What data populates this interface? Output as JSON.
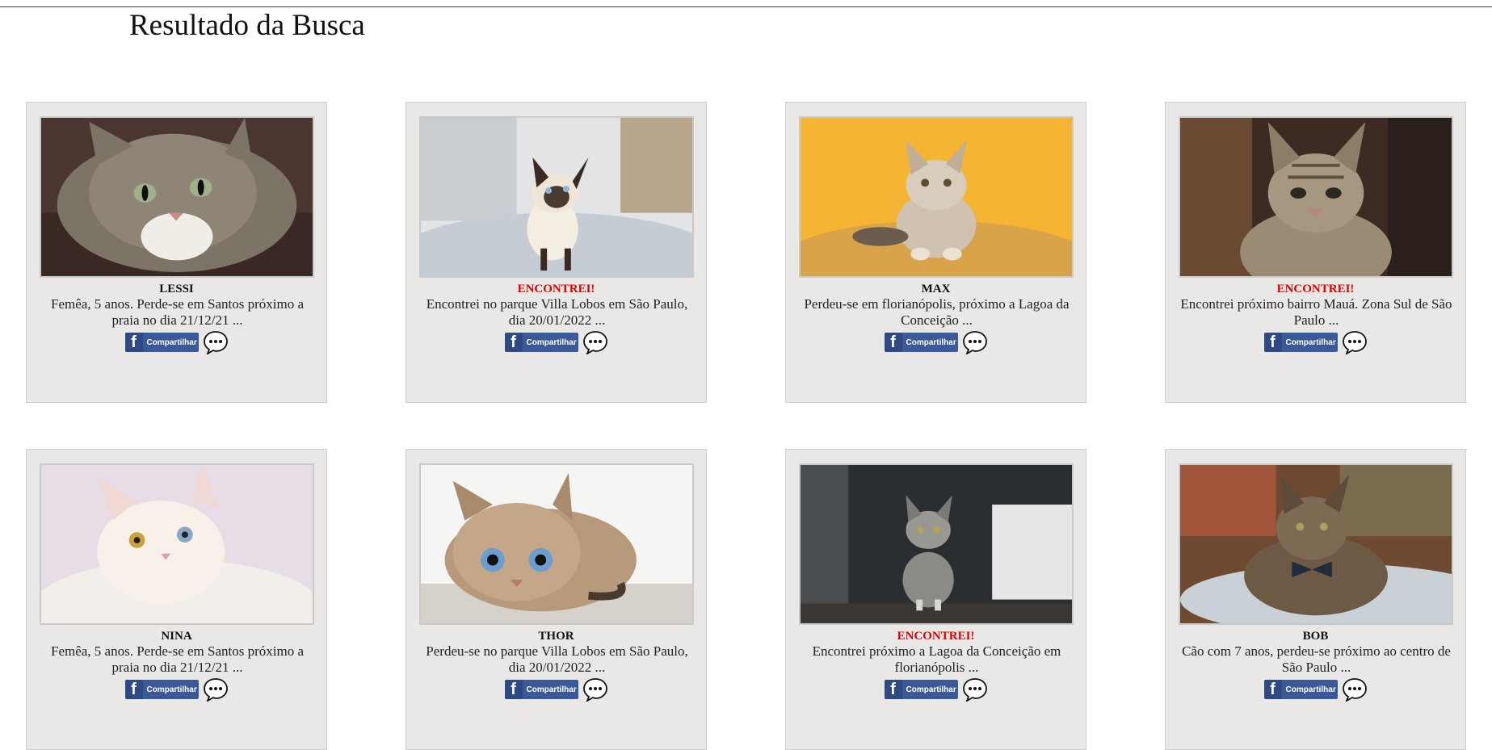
{
  "page": {
    "title": "Resultado da Busca"
  },
  "share_label": "Compartilhar",
  "colors": {
    "found": "#e10000",
    "card_bg": "#e9e8e7",
    "facebook": "#3b5998"
  },
  "cards": [
    {
      "name": "LESSI",
      "status": "lost",
      "description": "Femêa, 5 anos. Perde-se em Santos próximo a praia no dia 21/12/21 ...",
      "photo": "tabby-cat-photo"
    },
    {
      "name": "ENCONTREI!",
      "status": "found",
      "description": "Encontrei no parque Villa Lobos em São Paulo, dia 20/01/2022 ...",
      "photo": "siamese-kitten-photo"
    },
    {
      "name": "MAX",
      "status": "lost",
      "description": "Perdeu-se em florianópolis, próximo a Lagoa da Conceição ...",
      "photo": "fluffy-kitten-photo"
    },
    {
      "name": "ENCONTREI!",
      "status": "found",
      "description": "Encontrei próximo bairro Mauá. Zona Sul de São Paulo ...",
      "photo": "tabby-kitten-photo"
    },
    {
      "name": "NINA",
      "status": "lost",
      "description": "Femêa, 5 anos. Perde-se em Santos próximo a praia no dia 21/12/21 ...",
      "photo": "white-cat-photo"
    },
    {
      "name": "THOR",
      "status": "lost",
      "description": "Perdeu-se no parque Villa Lobos em São Paulo, dia 20/01/2022 ...",
      "photo": "blue-eyed-cat-photo"
    },
    {
      "name": "ENCONTREI!",
      "status": "found",
      "description": "Encontrei próximo a Lagoa da Conceição em florianópolis ...",
      "photo": "grey-kitten-photo"
    },
    {
      "name": "BOB",
      "status": "lost",
      "description": "Cão com 7 anos, perdeu-se próximo ao centro de São Paulo ...",
      "photo": "bowtie-cat-photo"
    }
  ]
}
